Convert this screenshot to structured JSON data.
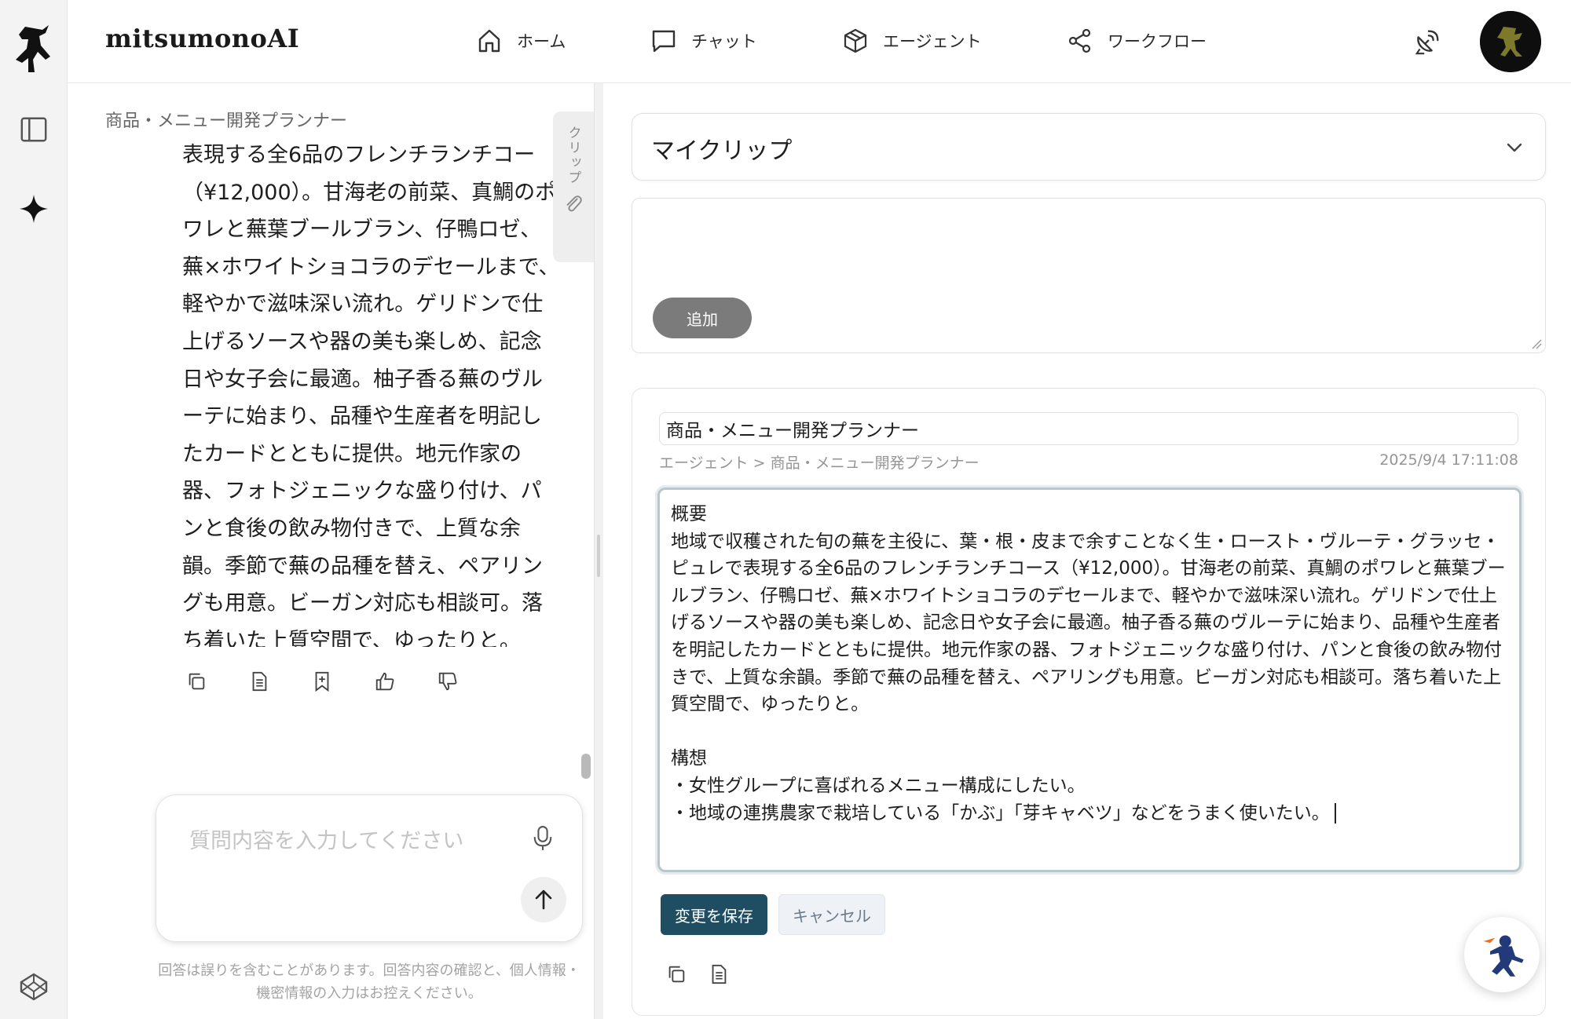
{
  "app": {
    "brand": "mitsumonoAI"
  },
  "nav": [
    {
      "label": "ホーム",
      "icon": "home-icon"
    },
    {
      "label": "チャット",
      "icon": "chat-icon"
    },
    {
      "label": "エージェント",
      "icon": "cube-icon"
    },
    {
      "label": "ワークフロー",
      "icon": "share-nodes-icon"
    }
  ],
  "chat": {
    "agent_name": "商品・メニュー開発プランナー",
    "message": "表現する全6品のフレンチランチコース（¥12,000）。甘海老の前菜、真鯛のポワレと蕪葉ブールブラン、仔鴨ロゼ、蕪×ホワイトショコラのデセールまで、軽やかで滋味深い流れ。ゲリドンで仕上げるソースや器の美も楽しめ、記念日や女子会に最適。柚子香る蕪のヴルーテに始まり、品種や生産者を明記したカードとともに提供。地元作家の器、フォトジェニックな盛り付け、パンと食後の飲み物付きで、上質な余韻。季節で蕪の品種を替え、ペアリングも用意。ビーガン対応も相談可。落ち着いた上質空間で、ゆったりと。",
    "message_lines": [
      "表現する全6品のフレンチランチコー",
      "（¥12,000）。甘海老の前菜、真鯛のポ",
      "ワレと蕪葉ブールブラン、仔鴨ロゼ、",
      "蕪×ホワイトショコラのデセールまで、",
      "軽やかで滋味深い流れ。ゲリドンで仕",
      "上げるソースや器の美も楽しめ、記念",
      "日や女子会に最適。柚子香る蕪のヴル",
      "ーテに始まり、品種や生産者を明記し",
      "たカードとともに提供。地元作家の",
      "器、フォトジェニックな盛り付け、パ",
      "ンと食後の飲み物付きで、上質な余",
      "韻。季節で蕪の品種を替え、ペアリン",
      "グも用意。ビーガン対応も相談可。落",
      "ち着いた上質空間で、ゆったりと。"
    ],
    "clip_tab_label": "クリップ",
    "input_placeholder": "質問内容を入力してください",
    "disclaimer": "回答は誤りを含むことがあります。回答内容の確認と、個人情報・機密情報の入力はお控えください。"
  },
  "clip": {
    "section_title": "マイクリップ",
    "add_button": "追加",
    "card": {
      "title": "商品・メニュー開発プランナー",
      "breadcrumb": "エージェント > 商品・メニュー開発プランナー",
      "timestamp": "2025/9/4 17:11:08",
      "body": "概要\n地域で収穫された旬の蕪を主役に、葉・根・皮まで余すことなく生・ロースト・ヴルーテ・グラッセ・ピュレで表現する全6品のフレンチランチコース（¥12,000）。甘海老の前菜、真鯛のポワレと蕪葉ブールブラン、仔鴨ロゼ、蕪×ホワイトショコラのデセールまで、軽やかで滋味深い流れ。ゲリドンで仕上げるソースや器の美も楽しめ、記念日や女子会に最適。柚子香る蕪のヴルーテに始まり、品種や生産者を明記したカードとともに提供。地元作家の器、フォトジェニックな盛り付け、パンと食後の飲み物付きで、上質な余韻。季節で蕪の品種を替え、ペアリングも用意。ビーガン対応も相談可。落ち着いた上質空間で、ゆったりと。\n\n構想\n・女性グループに喜ばれるメニュー構成にしたい。\n・地域の連携農家で栽培している「かぶ」「芽キャベツ」などをうまく使いたい。",
      "save_button": "変更を保存",
      "cancel_button": "キャンセル"
    }
  },
  "colors": {
    "save_button": "#1f4e63",
    "add_button": "#7b7b7b",
    "rail_bg": "#f3f3f3"
  }
}
